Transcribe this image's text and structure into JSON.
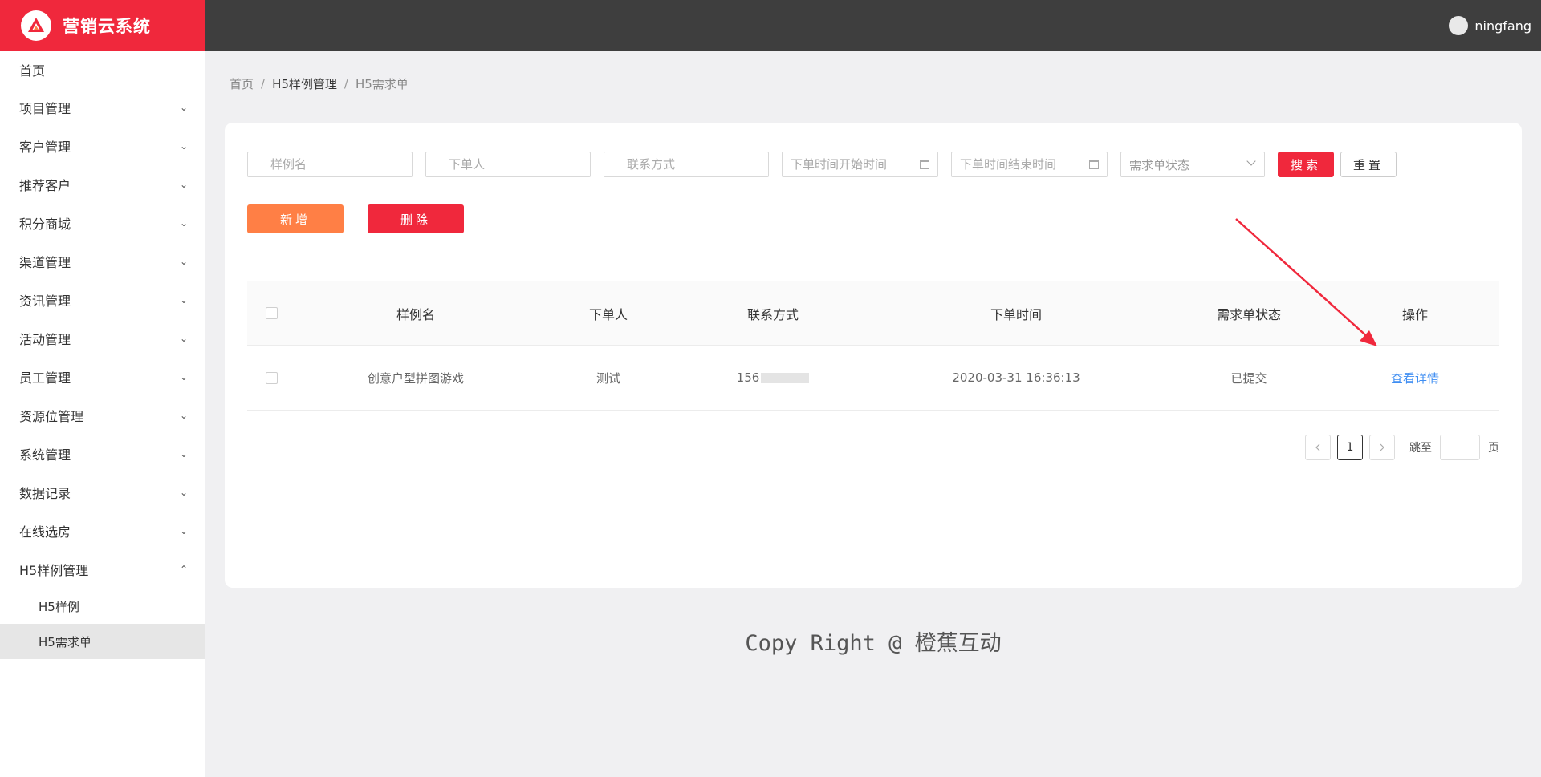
{
  "app": {
    "title": "营销云系统",
    "user": "ningfang"
  },
  "sidebar": {
    "home": "首页",
    "items": [
      "项目管理",
      "客户管理",
      "推荐客户",
      "积分商城",
      "渠道管理",
      "资讯管理",
      "活动管理",
      "员工管理",
      "资源位管理",
      "系统管理",
      "数据记录",
      "在线选房"
    ],
    "open_group": "H5样例管理",
    "sub_items": [
      "H5样例",
      "H5需求单"
    ]
  },
  "breadcrumb": [
    "首页",
    "H5样例管理",
    "H5需求单"
  ],
  "filters": {
    "sample_name_ph": "样例名",
    "orderer_ph": "下单人",
    "contact_ph": "联系方式",
    "start_ph": "下单时间开始时间",
    "end_ph": "下单时间结束时间",
    "status_ph": "需求单状态",
    "search": "搜索",
    "reset": "重置"
  },
  "actions": {
    "add": "新增",
    "delete": "删除"
  },
  "table": {
    "headers": [
      "样例名",
      "下单人",
      "联系方式",
      "下单时间",
      "需求单状态",
      "操作"
    ],
    "rows": [
      {
        "name": "创意户型拼图游戏",
        "user": "测试",
        "contact": "156",
        "time": "2020-03-31 16:36:13",
        "status": "已提交",
        "op": "查看详情"
      }
    ]
  },
  "pager": {
    "prev": "<",
    "current": "1",
    "next": ">",
    "jump_label": "跳至",
    "page_label": "页"
  },
  "footer": "Copy Right @ 橙蕉互动",
  "colors": {
    "brand": "#f0283c",
    "topbar": "#3e3e3e",
    "add": "#ff7f45",
    "link": "#3f8ef2"
  }
}
